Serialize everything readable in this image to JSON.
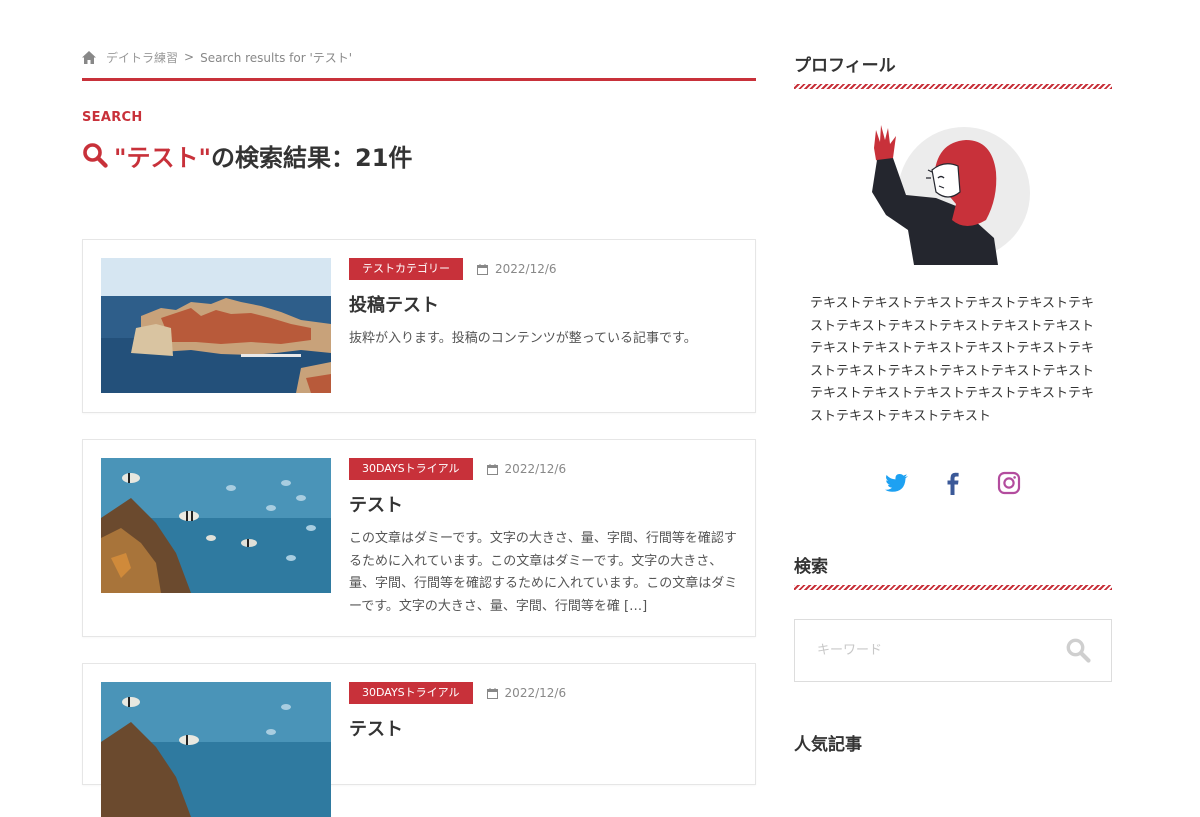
{
  "breadcrumb": {
    "home_label": "デイトラ練習",
    "separator": ">",
    "current": "Search results for 'テスト'"
  },
  "search_header": {
    "label": "SEARCH",
    "term": "\"テスト\"",
    "suffix": "の検索結果：21件"
  },
  "posts": [
    {
      "category": "テストカテゴリー",
      "date": "2022/12/6",
      "title": "投稿テスト",
      "excerpt": "抜粋が入ります。投稿のコンテンツが整っている記事です。",
      "thumbnail": "coastal-old-town-icon"
    },
    {
      "category": "30DAYSトライアル",
      "date": "2022/12/6",
      "title": "テスト",
      "excerpt": "この文章はダミーです。文字の大きさ、量、字間、行間等を確認するために入れています。この文章はダミーです。文字の大きさ、量、字間、行間等を確認するために入れています。この文章はダミーです。文字の大きさ、量、字間、行間等を確 […]",
      "thumbnail": "reef-fish-icon"
    },
    {
      "category": "30DAYSトライアル",
      "date": "2022/12/6",
      "title": "テスト",
      "excerpt": "",
      "thumbnail": "reef-fish-icon"
    }
  ],
  "sidebar": {
    "profile": {
      "title": "プロフィール",
      "text": "テキストテキストテキストテキストテキストテキストテキストテキストテキストテキストテキストテキストテキストテキストテキストテキストテキストテキストテキストテキストテキストテキストテキストテキストテキストテキストテキストテキストテキストテキストテキスト",
      "social": [
        "twitter-icon",
        "facebook-icon",
        "instagram-icon"
      ]
    },
    "search": {
      "title": "検索",
      "placeholder": "キーワード"
    },
    "popular": {
      "title": "人気記事"
    }
  },
  "colors": {
    "accent": "#c8313a",
    "twitter": "#1da1f2",
    "facebook": "#3b5998",
    "instagram": "#b34c9e"
  }
}
